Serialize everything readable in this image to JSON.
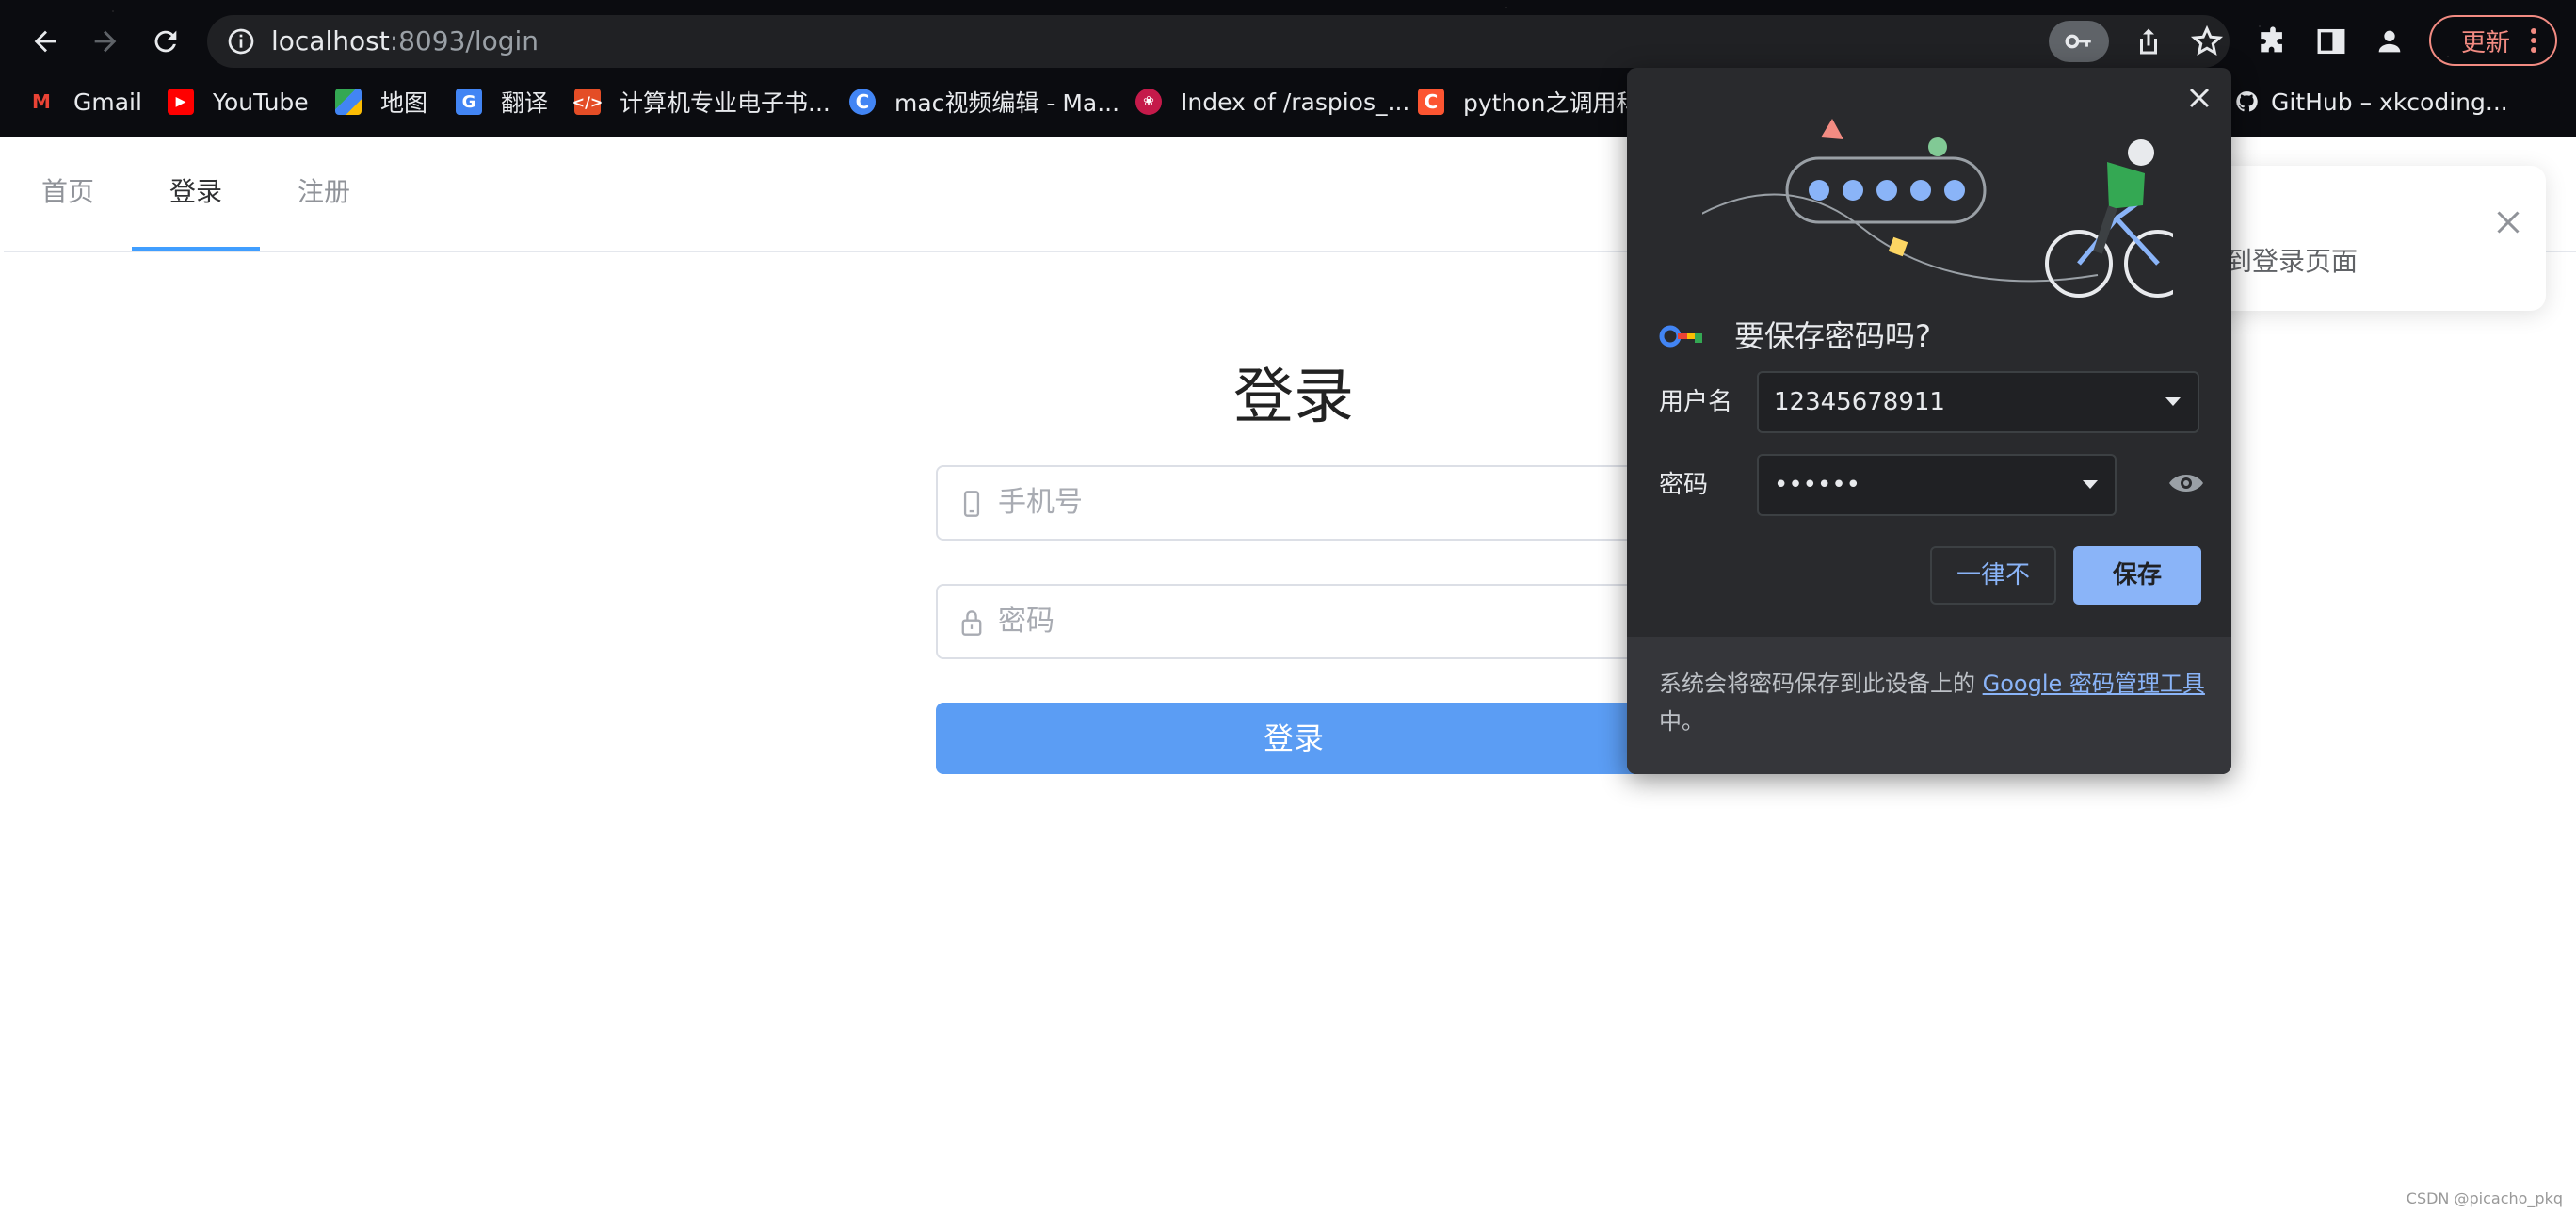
{
  "browser": {
    "url_host": "localhost",
    "url_path": ":8093/login",
    "update_label": "更新"
  },
  "bookmarks": [
    {
      "label": "Gmail",
      "icon": "gmail-icon",
      "color": "#ea4335"
    },
    {
      "label": "YouTube",
      "icon": "youtube-icon",
      "color": "#ff0000"
    },
    {
      "label": "地图",
      "icon": "maps-icon",
      "color": "#34a853"
    },
    {
      "label": "翻译",
      "icon": "translate-icon",
      "color": "#4285f4"
    },
    {
      "label": "计算机专业电子书...",
      "icon": "code-icon",
      "color": "#e44d26"
    },
    {
      "label": "mac视频编辑 - Ma...",
      "icon": "c-circle-icon",
      "color": "#4285f4"
    },
    {
      "label": "Index of /raspios_...",
      "icon": "raspberry-icon",
      "color": "#c51a4a"
    },
    {
      "label": "python之调用科",
      "icon": "csdn-icon",
      "color": "#fc5531"
    },
    {
      "label": "GitHub – xkcoding...",
      "icon": "github-icon",
      "color": "#ffffff"
    }
  ],
  "page": {
    "tabs": [
      {
        "label": "首页"
      },
      {
        "label": "登录"
      },
      {
        "label": "注册"
      }
    ],
    "active_tab": 1,
    "login_title": "登录",
    "phone_placeholder": "手机号",
    "password_placeholder": "密码",
    "login_button": "登录",
    "toast_text": "到登录页面",
    "watermark": "CSDN @picacho_pkq"
  },
  "password_bubble": {
    "title": "要保存密码吗?",
    "username_label": "用户名",
    "username_value": "12345678911",
    "password_label": "密码",
    "password_value": "••••••",
    "never_button": "一律不",
    "save_button": "保存",
    "footer_text": "系统会将密码保存到此设备上的",
    "footer_link": "Google 密码管理工具",
    "footer_suffix": "中。"
  },
  "colors": {
    "accent": "#409eff",
    "login_button": "#5b9df4",
    "bubble_bg": "#292a2d",
    "bubble_accent": "#8ab4f8",
    "update": "#f28b82"
  }
}
